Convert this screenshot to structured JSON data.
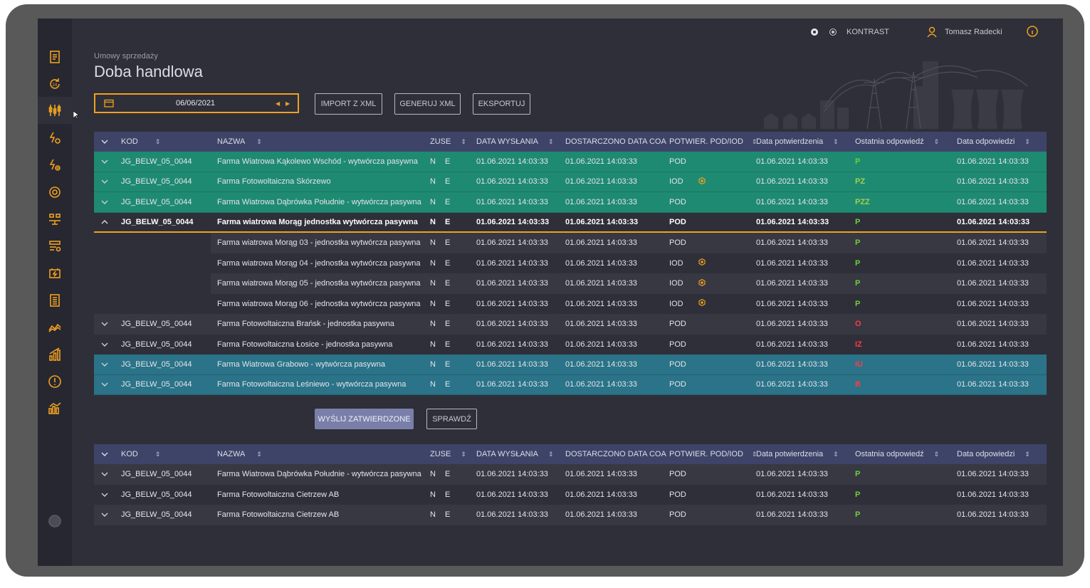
{
  "topbar": {
    "contrast_label": "KONTRAST",
    "user_name": "Tomasz Radecki"
  },
  "page": {
    "subtitle": "Umowy sprzedaży",
    "title": "Doba handlowa"
  },
  "toolbar": {
    "date": "06/06/2021",
    "import_label": "IMPORT Z XML",
    "generate_label": "GENERUJ XML",
    "export_label": "EKSPORTUJ"
  },
  "table_headers": {
    "kod": "KOD",
    "nazwa": "NAZWA",
    "zuse": "ZUSE",
    "data_wyslania": "DATA WYSŁANIA",
    "dostarczono": "DOSTARCZONO DATA COA",
    "potwier": "POTWIER. POD/IOD",
    "data_potwierdzenia": "Data potwierdzenia",
    "ostatnia": "Ostatnia odpowiedź",
    "data_odpowiedzi": "Data odpowiedzi"
  },
  "main_rows": [
    {
      "kod": "JG_BELW_05_0044",
      "nazwa": "Farma Wiatrowa Kąkolewo Wschód - wytwórcza pasywna",
      "zn": "N",
      "ze": "E",
      "dw": "01.06.2021 14:03:33",
      "dc": "01.06.2021 14:03:33",
      "pod": "POD",
      "dp": "01.06.2021 14:03:33",
      "oo": "P",
      "do": "01.06.2021 14:03:33"
    },
    {
      "kod": "JG_BELW_05_0044",
      "nazwa": "Farma Fotowoltaiczna Skórzewo",
      "zn": "N",
      "ze": "E",
      "dw": "01.06.2021 14:03:33",
      "dc": "01.06.2021 14:03:33",
      "pod": "IOD",
      "dp": "01.06.2021 14:03:33",
      "oo": "PZ",
      "do": "01.06.2021 14:03:33"
    },
    {
      "kod": "JG_BELW_05_0044",
      "nazwa": "Farma Wiatrowa Dąbrówka Południe - wytwórcza pasywna",
      "zn": "N",
      "ze": "E",
      "dw": "01.06.2021 14:03:33",
      "dc": "01.06.2021 14:03:33",
      "pod": "POD",
      "dp": "01.06.2021 14:03:33",
      "oo": "PZZ",
      "do": "01.06.2021 14:03:33"
    },
    {
      "kod": "JG_BELW_05_0044",
      "nazwa": "Farma wiatrowa Morąg jednostka wytwórcza pasywna",
      "zn": "N",
      "ze": "E",
      "dw": "01.06.2021 14:03:33",
      "dc": "01.06.2021 14:03:33",
      "pod": "POD",
      "dp": "01.06.2021 14:03:33",
      "oo": "P",
      "do": "01.06.2021 14:03:33"
    },
    {
      "kod": "",
      "nazwa": "Farma wiatrowa Morąg 03 - jednostka wytwórcza pasywna",
      "zn": "N",
      "ze": "E",
      "dw": "01.06.2021 14:03:33",
      "dc": "01.06.2021 14:03:33",
      "pod": "POD",
      "dp": "01.06.2021 14:03:33",
      "oo": "P",
      "do": "01.06.2021 14:03:33"
    },
    {
      "kod": "",
      "nazwa": "Farma wiatrowa Morąg 04 - jednostka wytwórcza pasywna",
      "zn": "N",
      "ze": "E",
      "dw": "01.06.2021 14:03:33",
      "dc": "01.06.2021 14:03:33",
      "pod": "IOD",
      "dp": "01.06.2021 14:03:33",
      "oo": "P",
      "do": "01.06.2021 14:03:33"
    },
    {
      "kod": "",
      "nazwa": "Farma wiatrowa Morąg 05 - jednostka wytwórcza pasywna",
      "zn": "N",
      "ze": "E",
      "dw": "01.06.2021 14:03:33",
      "dc": "01.06.2021 14:03:33",
      "pod": "IOD",
      "dp": "01.06.2021 14:03:33",
      "oo": "P",
      "do": "01.06.2021 14:03:33"
    },
    {
      "kod": "",
      "nazwa": "Farma wiatrowa Morąg 06 - jednostka wytwórcza pasywna",
      "zn": "N",
      "ze": "E",
      "dw": "01.06.2021 14:03:33",
      "dc": "01.06.2021 14:03:33",
      "pod": "IOD",
      "dp": "01.06.2021 14:03:33",
      "oo": "P",
      "do": "01.06.2021 14:03:33"
    },
    {
      "kod": "JG_BELW_05_0044",
      "nazwa": "Farma Fotowoltaiczna Brańsk - jednostka pasywna",
      "zn": "N",
      "ze": "E",
      "dw": "01.06.2021 14:03:33",
      "dc": "01.06.2021 14:03:33",
      "pod": "POD",
      "dp": "01.06.2021 14:03:33",
      "oo": "O",
      "do": "01.06.2021 14:03:33"
    },
    {
      "kod": "JG_BELW_05_0044",
      "nazwa": "Farma Fotowoltaiczna Łosice - jednostka pasywna",
      "zn": "N",
      "ze": "E",
      "dw": "01.06.2021 14:03:33",
      "dc": "01.06.2021 14:03:33",
      "pod": "POD",
      "dp": "01.06.2021 14:03:33",
      "oo": "IZ",
      "do": "01.06.2021 14:03:33"
    },
    {
      "kod": "JG_BELW_05_0044",
      "nazwa": "Farma Wiatrowa Grabowo - wytwórcza pasywna",
      "zn": "N",
      "ze": "E",
      "dw": "01.06.2021 14:03:33",
      "dc": "01.06.2021 14:03:33",
      "pod": "POD",
      "dp": "01.06.2021 14:03:33",
      "oo": "IU",
      "do": "01.06.2021 14:03:33"
    },
    {
      "kod": "JG_BELW_05_0044",
      "nazwa": "Farma Fotowoltaiczna Leśniewo - wytwórcza pasywna",
      "zn": "N",
      "ze": "E",
      "dw": "01.06.2021 14:03:33",
      "dc": "01.06.2021 14:03:33",
      "pod": "POD",
      "dp": "01.06.2021 14:03:33",
      "oo": "B",
      "do": "01.06.2021 14:03:33"
    }
  ],
  "actions": {
    "send_label": "WYŚLIJ ZATWIERDZONE",
    "check_label": "SPRAWDŹ"
  },
  "second_rows": [
    {
      "kod": "JG_BELW_05_0044",
      "nazwa": "Farma Wiatrowa Dąbrówka Południe - wytwórcza pasywna",
      "zn": "N",
      "ze": "E",
      "dw": "01.06.2021 14:03:33",
      "dc": "01.06.2021 14:03:33",
      "pod": "POD",
      "dp": "01.06.2021 14:03:33",
      "oo": "P",
      "do": "01.06.2021 14:03:33"
    },
    {
      "kod": "JG_BELW_05_0044",
      "nazwa": "Farma Fotowoltaiczna Cietrzew AB",
      "zn": "N",
      "ze": "E",
      "dw": "01.06.2021 14:03:33",
      "dc": "01.06.2021 14:03:33",
      "pod": "POD",
      "dp": "01.06.2021 14:03:33",
      "oo": "P",
      "do": "01.06.2021 14:03:33"
    },
    {
      "kod": "JG_BELW_05_0044",
      "nazwa": "Farma Fotowoltaiczna Cietrzew AB",
      "zn": "N",
      "ze": "E",
      "dw": "01.06.2021 14:03:33",
      "dc": "01.06.2021 14:03:33",
      "pod": "POD",
      "dp": "01.06.2021 14:03:33",
      "oo": "P",
      "do": "01.06.2021 14:03:33"
    }
  ],
  "colors": {
    "accent": "#f0a020",
    "row_green": "#1f8a72",
    "row_teal": "#2a7388",
    "header": "#3e4468"
  }
}
